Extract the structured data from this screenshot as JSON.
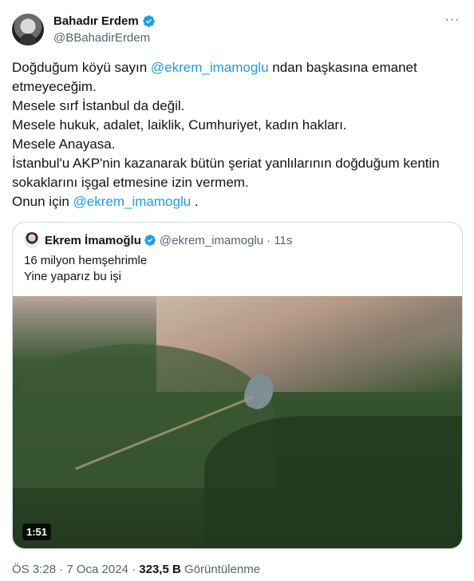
{
  "author": {
    "display_name": "Bahadır Erdem",
    "handle": "@BBahadirErdem"
  },
  "more_label": "···",
  "tweet": {
    "lines": [
      {
        "text_a": "Doğduğum köyü sayın ",
        "mention": "@ekrem_imamoglu",
        "text_b": " ndan başkasına emanet"
      },
      {
        "text": "etmeyeceğim."
      },
      {
        "text": "Mesele sırf İstanbul da değil."
      },
      {
        "text": "Mesele hukuk, adalet, laiklik, Cumhuriyet, kadın hakları."
      },
      {
        "text": "Mesele Anayasa."
      },
      {
        "text": "İstanbul'u AKP'nin kazanarak bütün şeriat yanlılarının doğduğum kentin"
      },
      {
        "text": "sokaklarını işgal etmesine izin vermem."
      },
      {
        "text_a": "Onun için ",
        "mention": "@ekrem_imamoglu",
        "text_b": " ."
      }
    ]
  },
  "quote": {
    "display_name": "Ekrem İmamoğlu",
    "handle": "@ekrem_imamoglu",
    "time": "· 11s",
    "line1": "16 milyon hemşehrimle",
    "line2": "Yine yaparız bu işi",
    "video_duration": "1:51"
  },
  "meta": {
    "timestamp": "ÖS 3:28 · 7 Oca 2024 · ",
    "views_count": "323,5 B",
    "views_label": " Görüntülenme"
  },
  "colors": {
    "accent": "#1d9bf0",
    "text": "#0f1419",
    "secondary": "#536471"
  }
}
